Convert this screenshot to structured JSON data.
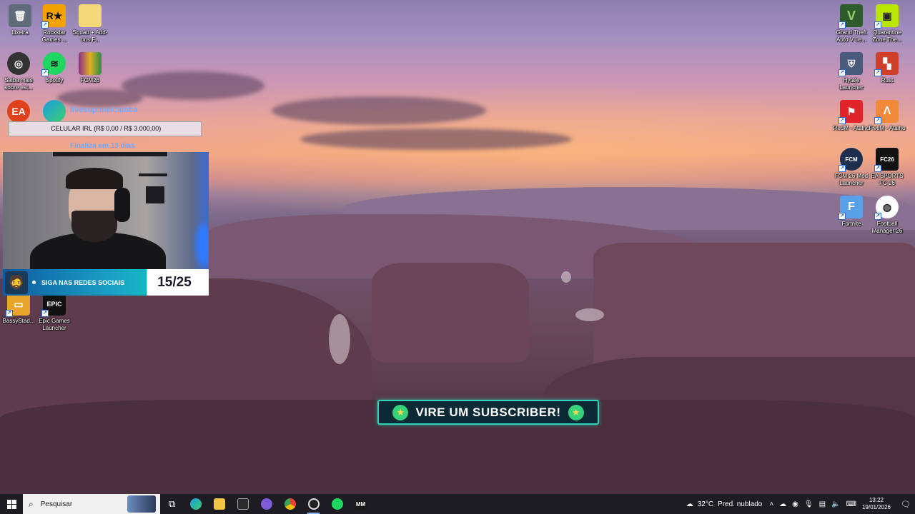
{
  "desktop_icons_left": [
    {
      "id": "lixeira",
      "label": "Lixeira",
      "icon": "recycle-bin-icon",
      "color": "#5f6b7a"
    },
    {
      "id": "rockstar",
      "label": "Rockstar Games ...",
      "icon": "rockstar-icon",
      "color": "#f4a200"
    },
    {
      "id": "squad",
      "label": "Squad + Add-ons F...",
      "icon": "folder-icon",
      "color": "#f4d97a"
    },
    {
      "id": "saiba",
      "label": "Saiba mais sobre est...",
      "icon": "camera-icon",
      "color": "#333333"
    },
    {
      "id": "spotify",
      "label": "Spotify",
      "icon": "spotify-icon",
      "color": "#1ed760"
    },
    {
      "id": "fcm26",
      "label": "FCM26",
      "icon": "rar-icon",
      "color": "#8b2a8b"
    },
    {
      "id": "bassy",
      "label": "BassyStad...",
      "icon": "package-icon",
      "color": "#e8a52a"
    },
    {
      "id": "epic",
      "label": "Epic Games Launcher",
      "icon": "epic-games-icon",
      "color": "#111111"
    }
  ],
  "desktop_icons_right": [
    {
      "id": "gta",
      "label": "Grand Theft Auto V Le...",
      "icon": "gta-v-icon",
      "color": "#2f5a2c"
    },
    {
      "id": "quarantine",
      "label": "Quarantine Zone The...",
      "icon": "quarantine-zone-icon",
      "color": "#b8e600"
    },
    {
      "id": "hytale",
      "label": "Hytale Launcher",
      "icon": "hytale-icon",
      "color": "#4a5a7a"
    },
    {
      "id": "rust",
      "label": "Rust",
      "icon": "rust-icon",
      "color": "#cd412b"
    },
    {
      "id": "redm",
      "label": "RedM - Atalho",
      "icon": "redm-icon",
      "color": "#e0242a"
    },
    {
      "id": "fivem",
      "label": "FiveM - Atalho",
      "icon": "fivem-icon",
      "color": "#f08a3a"
    },
    {
      "id": "fcm26mod",
      "label": "FCM 26 Mod Launcher",
      "icon": "fcm26-icon",
      "color": "#1e2e4e"
    },
    {
      "id": "easports",
      "label": "EA SPORTS FC 26",
      "icon": "ea-fc26-icon",
      "color": "#111111"
    },
    {
      "id": "fortnite",
      "label": "Fortnite",
      "icon": "fortnite-icon",
      "color": "#5aa0e8"
    },
    {
      "id": "fm26",
      "label": "Football Manager 26",
      "icon": "football-manager-icon",
      "color": "#ffffff"
    }
  ],
  "overlay": {
    "link": "livesup.me/caioba",
    "goal": "CELULAR IRL (R$ 0,00 / R$ 3.000,00)",
    "ends": "Finaliza em 13 dias",
    "social_text": "SIGA NAS REDES SOCIAIS",
    "social_count": "15/25",
    "subscriber": "VIRE UM SUBSCRIBER!"
  },
  "taskbar": {
    "search_placeholder": "Pesquisar",
    "weather_temp": "32°C",
    "weather_desc": "Pred. nublado",
    "time": "13:22",
    "date": "19/01/2026"
  },
  "colors": {
    "taskbar": "#1c1c22",
    "accent": "#2fd3b8",
    "link": "#6fa8ff"
  }
}
